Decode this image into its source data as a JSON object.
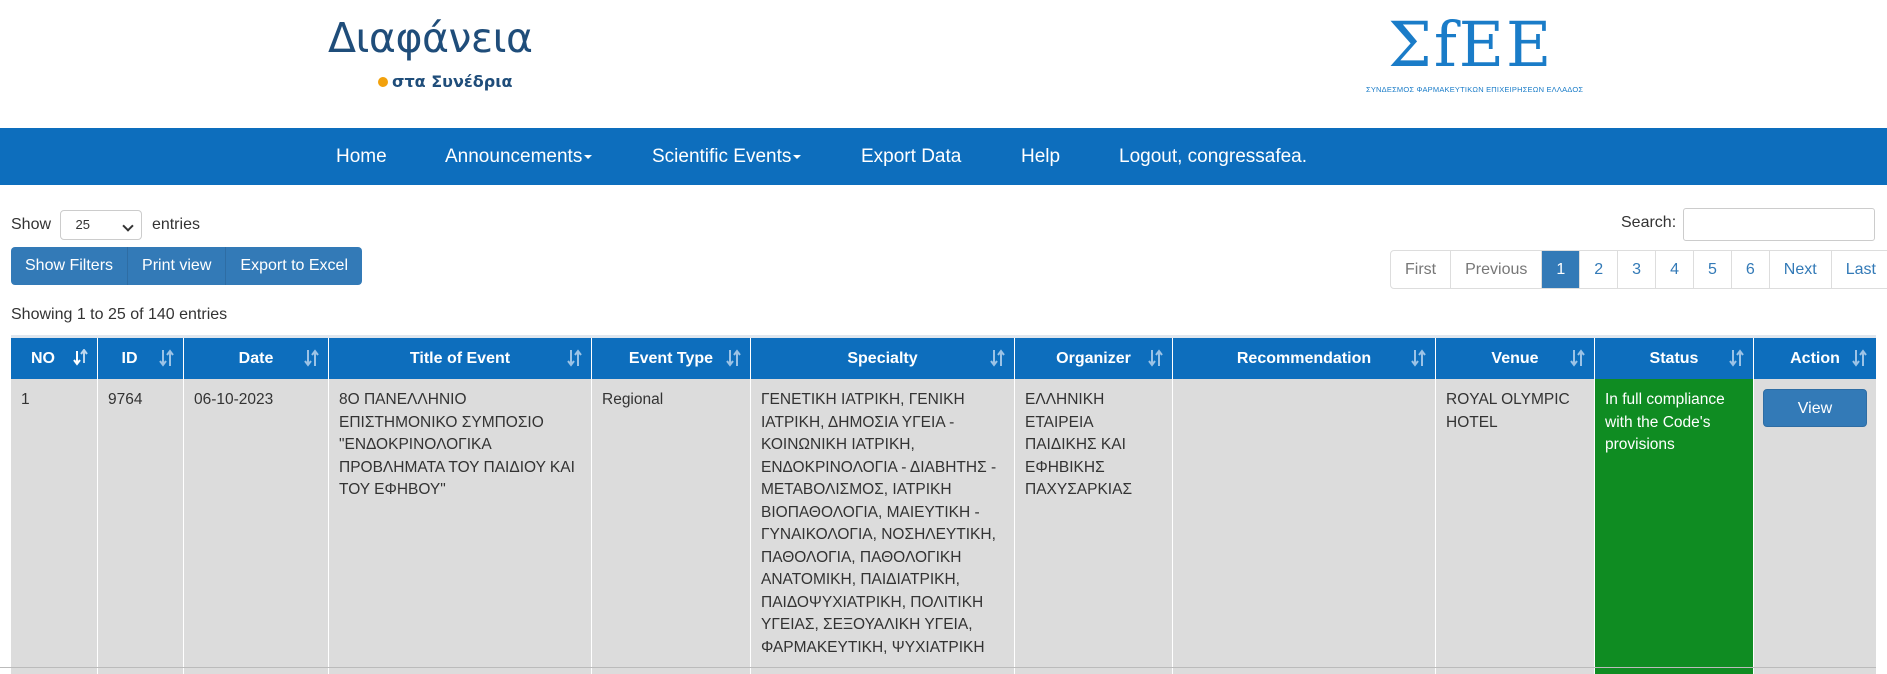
{
  "header": {
    "left_logo": {
      "main": "Διαφάνεια",
      "sub": "στα Συνέδρια"
    },
    "right_logo": {
      "main": "ΣfΕΕ",
      "sub": "ΣΥΝΔΕΣΜΟΣ ΦΑΡΜΑΚΕΥΤΙΚΩΝ ΕΠΙΧΕΙΡΗΣΕΩΝ ΕΛΛΑΔΟΣ"
    }
  },
  "nav": {
    "items": [
      {
        "label": "Home",
        "dropdown": false
      },
      {
        "label": "Announcements",
        "dropdown": true
      },
      {
        "label": "Scientific Events",
        "dropdown": true
      },
      {
        "label": "Export Data",
        "dropdown": false
      },
      {
        "label": "Help",
        "dropdown": false
      },
      {
        "label": "Logout, congressafea.",
        "dropdown": false
      }
    ]
  },
  "controls": {
    "show_label": "Show",
    "entries_label": "entries",
    "page_length": "25",
    "search_label": "Search:",
    "search_value": "",
    "buttons": [
      "Show Filters",
      "Print view",
      "Export to Excel"
    ],
    "pagination": [
      "First",
      "Previous",
      "1",
      "2",
      "3",
      "4",
      "5",
      "6",
      "Next",
      "Last"
    ],
    "current_page": "1",
    "info": "Showing 1 to 25 of 140 entries"
  },
  "table": {
    "columns": [
      "NO",
      "ID",
      "Date",
      "Title of Event",
      "Event Type",
      "Specialty",
      "Organizer",
      "Recommendation",
      "Venue",
      "Status",
      "Action"
    ],
    "rows": [
      {
        "no": "1",
        "id": "9764",
        "date": "06-10-2023",
        "title": "8Ο ΠΑΝΕΛΛΗΝΙΟ ΕΠΙΣΤΗΜΟΝΙΚΟ ΣΥΜΠΟΣΙΟ \"ΕΝΔΟΚΡΙΝΟΛΟΓΙΚΑ ΠΡΟΒΛΗΜΑΤΑ ΤΟΥ ΠΑΙΔΙΟΥ ΚΑΙ ΤΟΥ ΕΦΗΒΟΥ\"",
        "event_type": "Regional",
        "specialty": "ΓΕΝΕΤΙΚΗ ΙΑΤΡΙΚΗ, ΓΕΝΙΚΗ ΙΑΤΡΙΚΗ, ΔΗΜΟΣΙΑ ΥΓΕΙΑ - ΚΟΙΝΩΝΙΚΗ ΙΑΤΡΙΚΗ, ΕΝΔΟΚΡΙΝΟΛΟΓΙΑ - ΔΙΑΒΗΤΗΣ - ΜΕΤΑΒΟΛΙΣΜΟΣ, ΙΑΤΡΙΚΗ ΒΙΟΠΑΘΟΛΟΓΙΑ, ΜΑΙΕΥΤΙΚΗ - ΓΥΝΑΙΚΟΛΟΓΙΑ, ΝΟΣΗΛΕΥΤΙΚΗ, ΠΑΘΟΛΟΓΙΑ, ΠΑΘΟΛΟΓΙΚΗ ΑΝΑΤΟΜΙΚΗ, ΠΑΙΔΙΑΤΡΙΚΗ, ΠΑΙΔΟΨΥΧΙΑΤΡΙΚΗ, ΠΟΛΙΤΙΚΗ ΥΓΕΙΑΣ, ΣΕΞΟΥΑΛΙΚΗ ΥΓΕΙΑ, ΦΑΡΜΑΚΕΥΤΙΚΗ, ΨΥΧΙΑΤΡΙΚΗ",
        "organizer": "ΕΛΛΗΝΙΚΗ ΕΤΑΙΡΕΙΑ ΠΑΙΔΙΚΗΣ ΚΑΙ ΕΦΗΒΙΚΗΣ ΠΑΧΥΣΑΡΚΙΑΣ",
        "recommendation": "",
        "venue": "ROYAL OLYMPIC HOTEL",
        "status": "In full compliance with the Code's provisions",
        "action": "View"
      }
    ]
  },
  "colors": {
    "nav_bg": "#0d6ebd",
    "button_bg": "#337ab7",
    "status_ok": "#0f8c22",
    "row_bg": "#dcdcdc"
  }
}
